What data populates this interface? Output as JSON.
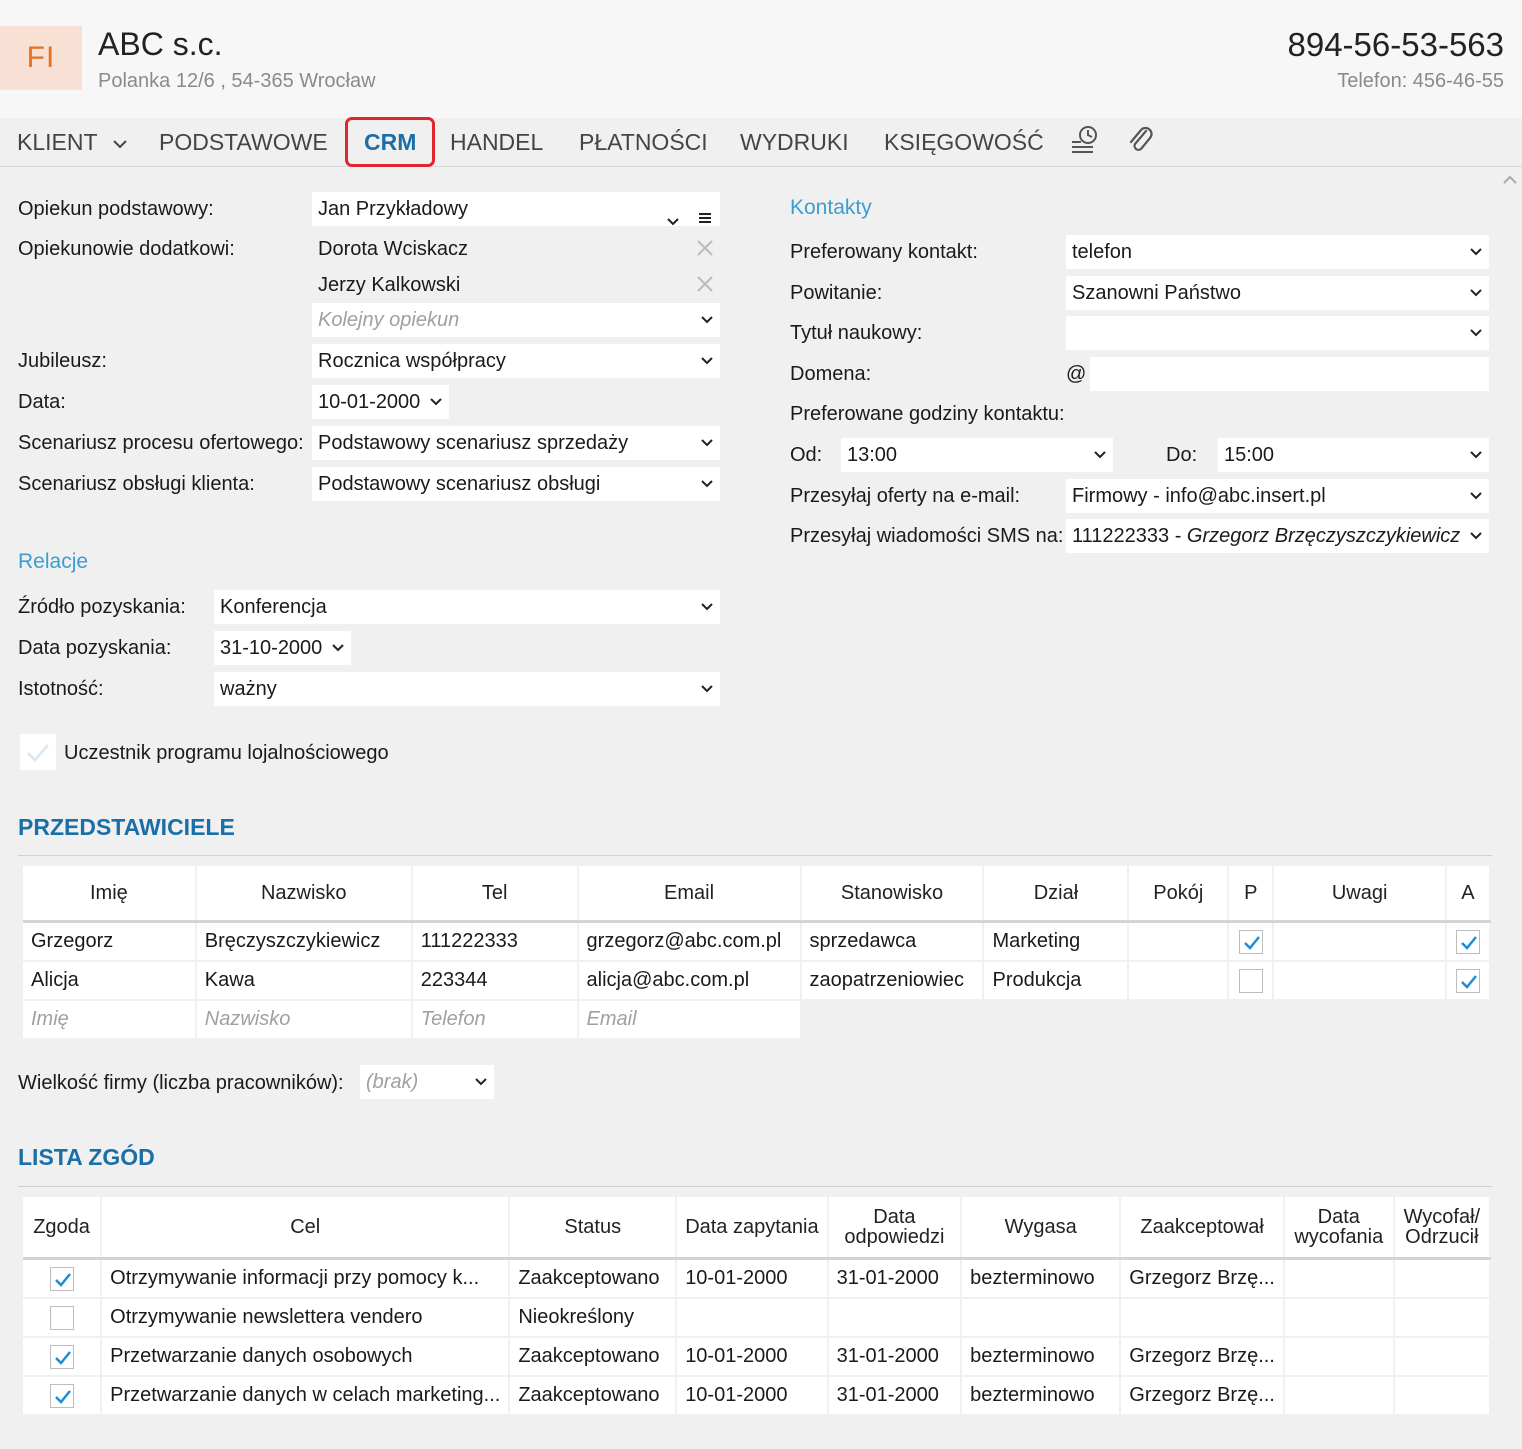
{
  "header": {
    "logo_text": "FI",
    "company": "ABC s.c.",
    "address": "Polanka  12/6 , 54-365 Wrocław",
    "nip": "894-56-53-563",
    "phone": "Telefon: 456-46-55"
  },
  "tabs": {
    "klient": "KLIENT",
    "podstawowe": "PODSTAWOWE",
    "crm": "CRM",
    "handel": "HANDEL",
    "platnosci": "PŁATNOŚCI",
    "wydruki": "WYDRUKI",
    "ksiegowosc": "KSIĘGOWOŚĆ"
  },
  "left": {
    "opiekun_label": "Opiekun podstawowy:",
    "opiekun_value": "Jan Przykładowy",
    "dodatkowi_label": "Opiekunowie dodatkowi:",
    "dodatkowi": [
      "Dorota Wciskacz",
      "Jerzy Kalkowski"
    ],
    "kolejny_placeholder": "Kolejny opiekun",
    "jubileusz_label": "Jubileusz:",
    "jubileusz_value": "Rocznica współpracy",
    "data_label": "Data:",
    "data_value": "10-01-2000",
    "scen_ofert_label": "Scenariusz procesu ofertowego:",
    "scen_ofert_value": "Podstawowy scenariusz sprzedaży",
    "scen_obsl_label": "Scenariusz obsługi klienta:",
    "scen_obsl_value": "Podstawowy scenariusz obsługi"
  },
  "relacje": {
    "title": "Relacje",
    "zrodlo_label": "Źródło pozyskania:",
    "zrodlo_value": "Konferencja",
    "data_label": "Data pozyskania:",
    "data_value": "31-10-2000",
    "istotnosc_label": "Istotność:",
    "istotnosc_value": "ważny",
    "lojalnosc_label": "Uczestnik programu lojalnościowego"
  },
  "kontakty": {
    "title": "Kontakty",
    "pref_label": "Preferowany kontakt:",
    "pref_value": "telefon",
    "powitanie_label": "Powitanie:",
    "powitanie_value": "Szanowni Państwo",
    "tytul_label": "Tytuł naukowy:",
    "tytul_value": "",
    "domena_label": "Domena:",
    "domena_at": "@",
    "domena_value": "",
    "godziny_label": "Preferowane godziny kontaktu:",
    "od_label": "Od:",
    "od_value": "13:00",
    "do_label": "Do:",
    "do_value": "15:00",
    "oferty_label": "Przesyłaj oferty na e-mail:",
    "oferty_value": "Firmowy - info@abc.insert.pl",
    "sms_label": "Przesyłaj wiadomości SMS na:",
    "sms_number": "111222333 - ",
    "sms_name": "Grzegorz Brzęczyszczykiewicz"
  },
  "przedstawiciele": {
    "title": "PRZEDSTAWICIELE",
    "columns": [
      "Imię",
      "Nazwisko",
      "Tel",
      "Email",
      "Stanowisko",
      "Dział",
      "Pokój",
      "P",
      "Uwagi",
      "A"
    ],
    "rows": [
      {
        "imie": "Grzegorz",
        "nazwisko": "Bręczyszczykiewicz",
        "tel": "111222333",
        "email": "grzegorz@abc.com.pl",
        "stanowisko": "sprzedawca",
        "dzial": "Marketing",
        "pokoj": "",
        "p": true,
        "uwagi": "",
        "a": true
      },
      {
        "imie": "Alicja",
        "nazwisko": "Kawa",
        "tel": "223344",
        "email": "alicja@abc.com.pl",
        "stanowisko": "zaopatrzeniowiec",
        "dzial": "Produkcja",
        "pokoj": "",
        "p": false,
        "uwagi": "",
        "a": true
      }
    ],
    "placeholders": {
      "imie": "Imię",
      "nazwisko": "Nazwisko",
      "tel": "Telefon",
      "email": "Email"
    }
  },
  "wielkosc": {
    "label": "Wielkość firmy (liczba pracowników):",
    "value": "(brak)"
  },
  "zgody": {
    "title": "LISTA ZGÓD",
    "columns": {
      "zgoda": "Zgoda",
      "cel": "Cel",
      "status": "Status",
      "data_zap": "Data zapytania",
      "data_odp_1": "Data",
      "data_odp_2": "odpowiedzi",
      "wygasa": "Wygasa",
      "zaakc": "Zaakceptował",
      "data_wyc_1": "Data",
      "data_wyc_2": "wycofania",
      "wycofal_1": "Wycofał/",
      "wycofal_2": "Odrzucił"
    },
    "rows": [
      {
        "zgoda": true,
        "cel": "Otrzymywanie informacji przy pomocy k...",
        "status": "Zaakceptowano",
        "data_zap": "10-01-2000",
        "data_odp": "31-01-2000",
        "wygasa": "bezterminowo",
        "zaakc": "Grzegorz Brzę..."
      },
      {
        "zgoda": false,
        "cel": "Otrzymywanie newslettera vendero",
        "status": "Nieokreślony",
        "data_zap": "",
        "data_odp": "",
        "wygasa": "",
        "zaakc": ""
      },
      {
        "zgoda": true,
        "cel": "Przetwarzanie danych osobowych",
        "status": "Zaakceptowano",
        "data_zap": "10-01-2000",
        "data_odp": "31-01-2000",
        "wygasa": "bezterminowo",
        "zaakc": "Grzegorz Brzę..."
      },
      {
        "zgoda": true,
        "cel": "Przetwarzanie danych w celach marketing...",
        "status": "Zaakceptowano",
        "data_zap": "10-01-2000",
        "data_odp": "31-01-2000",
        "wygasa": "bezterminowo",
        "zaakc": "Grzegorz Brzę..."
      }
    ]
  },
  "colors": {
    "accent": "#1b6fa8",
    "section": "#3a9fd0",
    "active_tab_border": "#e0262e",
    "logo": "#e8701f",
    "check": "#1a8fd8"
  },
  "icons": [
    "chevron-down-icon",
    "list-icon",
    "close-icon",
    "history-icon",
    "paperclip-icon",
    "checkbox-check-icon",
    "scroll-up-icon"
  ]
}
